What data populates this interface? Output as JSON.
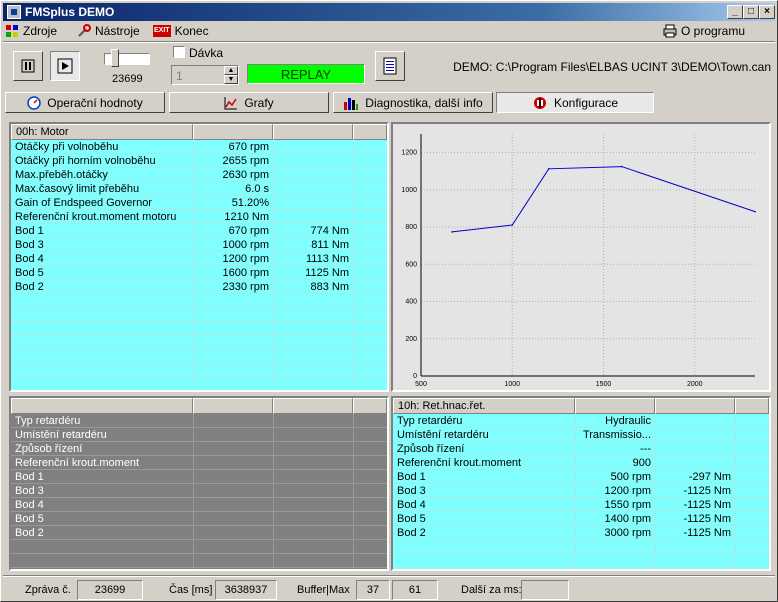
{
  "window": {
    "title": "FMSplus DEMO",
    "min": "_",
    "max": "□",
    "close": "×"
  },
  "menu": {
    "zdroje": "Zdroje",
    "nastroje": "Nástroje",
    "konec": "Konec",
    "about": "O programu",
    "exit_icon_text": "EXIT"
  },
  "toolbar": {
    "counter": "23699",
    "batch_label": "Dávka",
    "batch_value": "1",
    "replay": "REPLAY",
    "path": "DEMO: C:\\Program Files\\ELBAS UCINT 3\\DEMO\\Town.can"
  },
  "tabs": [
    {
      "label": "Operační hodnoty"
    },
    {
      "label": "Grafy"
    },
    {
      "label": "Diagnostika, další info"
    },
    {
      "label": "Konfigurace",
      "active": true
    }
  ],
  "motor_panel": {
    "header": "00h:  Motor",
    "rows": [
      {
        "name": "Otáčky při volnoběhu",
        "v1": "670 rpm",
        "v2": ""
      },
      {
        "name": "Otáčky při horním volnoběhu",
        "v1": "2655 rpm",
        "v2": ""
      },
      {
        "name": "Max.přeběh.otáčky",
        "v1": "2630 rpm",
        "v2": ""
      },
      {
        "name": "Max.časový limit přeběhu",
        "v1": "6.0 s",
        "v2": ""
      },
      {
        "name": "Gain of Endspeed Governor",
        "v1": "51.20%",
        "v2": ""
      },
      {
        "name": "Referenční krout.moment motoru",
        "v1": "1210 Nm",
        "v2": ""
      },
      {
        "name": "Bod 1",
        "v1": "670 rpm",
        "v2": "774 Nm"
      },
      {
        "name": "Bod 3",
        "v1": "1000 rpm",
        "v2": "811 Nm"
      },
      {
        "name": "Bod 4",
        "v1": "1200 rpm",
        "v2": "1113 Nm"
      },
      {
        "name": "Bod 5",
        "v1": "1600 rpm",
        "v2": "1125 Nm"
      },
      {
        "name": "Bod 2",
        "v1": "2330 rpm",
        "v2": "883 Nm"
      }
    ]
  },
  "retarder_left": {
    "header": "",
    "rows": [
      {
        "name": "Typ retardéru"
      },
      {
        "name": "Umístění retardéru"
      },
      {
        "name": "Způsob řízení"
      },
      {
        "name": "Referenční krout.moment"
      },
      {
        "name": "Bod 1"
      },
      {
        "name": "Bod 3"
      },
      {
        "name": "Bod 4"
      },
      {
        "name": "Bod 5"
      },
      {
        "name": "Bod 2"
      }
    ]
  },
  "retarder_right": {
    "header": "10h:  Ret.hnac.řet.",
    "rows": [
      {
        "name": "Typ retardéru",
        "v1": "Hydraulic",
        "v2": ""
      },
      {
        "name": "Umístění retardéru",
        "v1": "Transmissio...",
        "v2": ""
      },
      {
        "name": "Způsob řízení",
        "v1": "---",
        "v2": ""
      },
      {
        "name": "Referenční krout.moment",
        "v1": "900",
        "v2": ""
      },
      {
        "name": "Bod 1",
        "v1": "500 rpm",
        "v2": "-297 Nm"
      },
      {
        "name": "Bod 3",
        "v1": "1200 rpm",
        "v2": "-1125 Nm"
      },
      {
        "name": "Bod 4",
        "v1": "1550 rpm",
        "v2": "-1125 Nm"
      },
      {
        "name": "Bod 5",
        "v1": "1400 rpm",
        "v2": "-1125 Nm"
      },
      {
        "name": "Bod 2",
        "v1": "3000 rpm",
        "v2": "-1125 Nm"
      }
    ]
  },
  "chart_data": {
    "type": "line",
    "x": [
      670,
      1000,
      1200,
      1600,
      2330
    ],
    "series": [
      {
        "values": [
          774,
          811,
          1113,
          1125,
          883
        ],
        "color": "#0000cc"
      }
    ],
    "xlim": [
      500,
      2330
    ],
    "ylim": [
      0,
      1300
    ],
    "xticks": [
      500,
      1000,
      1500,
      2000
    ],
    "yticks": [
      0,
      200,
      400,
      600,
      800,
      1000,
      1200
    ],
    "grid": true
  },
  "status": {
    "msg_label": "Zpráva č.",
    "msg_value": "23699",
    "time_label": "Čas [ms]",
    "time_value": "3638937",
    "buffer_label": "Buffer|Max",
    "buffer_value": "37",
    "max_value": "61",
    "next_label": "Další za ms:",
    "next_value": ""
  },
  "colors": {
    "cyan": "#80ffff",
    "gray": "#808080",
    "replay_bg": "#00ff00",
    "title": "#0a246a"
  }
}
